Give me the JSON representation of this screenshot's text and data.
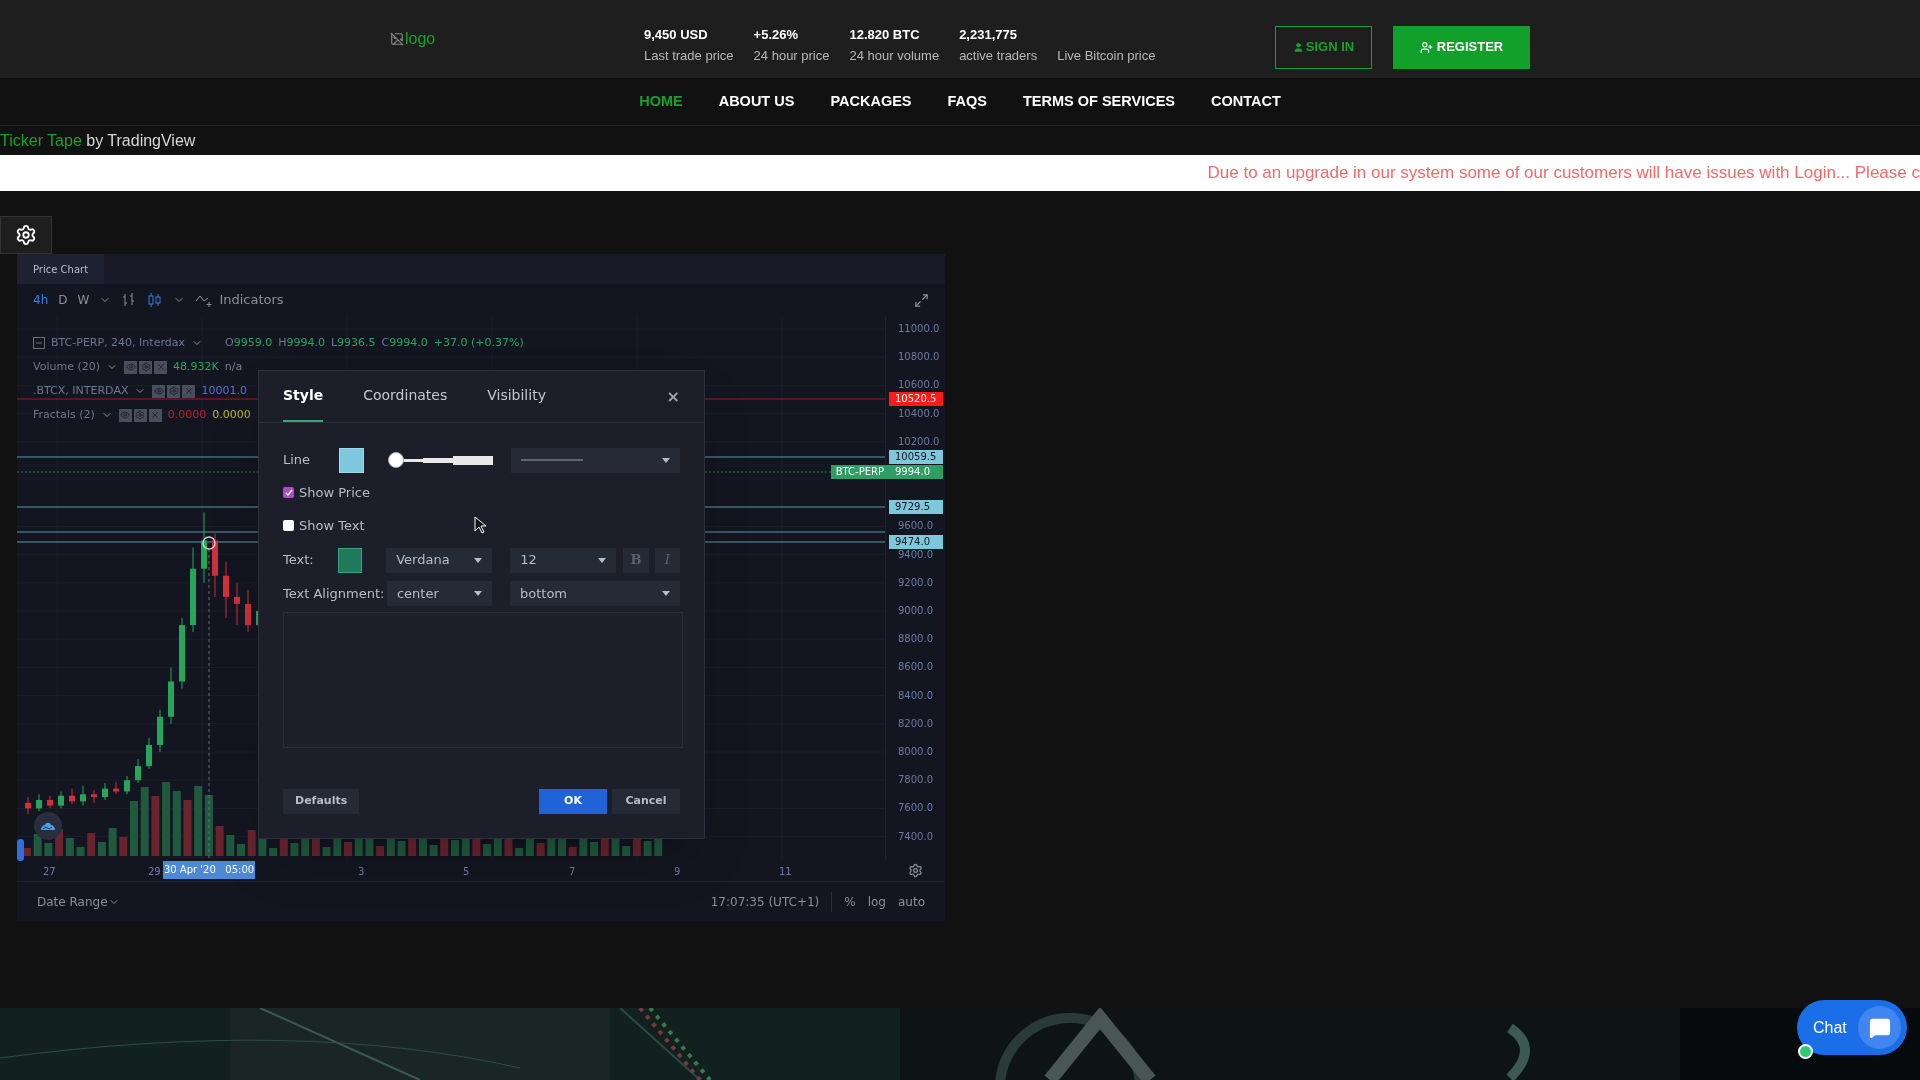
{
  "header": {
    "logo_alt": "logo",
    "stats": [
      {
        "value": "9,450 USD",
        "label": "Last trade price"
      },
      {
        "value": "+5.26%",
        "label": "24 hour price"
      },
      {
        "value": "12.820 BTC",
        "label": "24 hour volume"
      },
      {
        "value": "2,231,775",
        "label": "active traders"
      },
      {
        "label": "Live Bitcoin price"
      }
    ],
    "sign_in": "SIGN IN",
    "register": "REGISTER"
  },
  "nav": [
    {
      "label": "HOME",
      "selected": true
    },
    {
      "label": "ABOUT US",
      "selected": false
    },
    {
      "label": "PACKAGES",
      "selected": false
    },
    {
      "label": "FAQS",
      "selected": false
    },
    {
      "label": "TERMS OF SERVICES",
      "selected": false
    },
    {
      "label": "CONTACT",
      "selected": false
    }
  ],
  "ticker": {
    "link": "Ticker Tape",
    "suffix": "by TradingView"
  },
  "notice": "Due to an upgrade in our system some of our customers will have issues with Login... Please c",
  "chart_widget": {
    "tab": "Price Chart",
    "timeframes": [
      {
        "label": "4h",
        "selected": true
      },
      {
        "label": "D",
        "selected": false
      },
      {
        "label": "W",
        "selected": false
      }
    ],
    "indicators_label": "Indicators",
    "legend": [
      {
        "kind": "main",
        "name": "BTC-PERP, 240, Interdax",
        "ohlc": [
          {
            "key": "O",
            "value": "9959.0"
          },
          {
            "key": "H",
            "value": "9994.0"
          },
          {
            "key": "L",
            "value": "9936.5"
          },
          {
            "key": "C",
            "value": "9994.0"
          }
        ],
        "change": "+37.0 (+0.37%)"
      },
      {
        "kind": "study",
        "name": "Volume (20)",
        "values": [
          {
            "text": "48.932K",
            "color": "#26a65b"
          },
          {
            "text": "n/a",
            "color": "#7a8092"
          }
        ]
      },
      {
        "kind": "study",
        "name": ".BTCX, INTERDAX",
        "values": [
          {
            "text": "10001.0",
            "color": "#5b6fd8"
          }
        ]
      },
      {
        "kind": "study",
        "name": "Fractals (2)",
        "values": [
          {
            "text": "0.0000",
            "color": "#c0202a"
          },
          {
            "text": "0.0000",
            "color": "#b8b820"
          }
        ]
      }
    ],
    "price_axis": [
      "11000.0",
      "10800.0",
      "10600.0",
      "10400.0",
      "10200.0",
      "9600.0",
      "9400.0",
      "9200.0",
      "9000.0",
      "8800.0",
      "8600.0",
      "8400.0",
      "8200.0",
      "8000.0",
      "7800.0",
      "7600.0",
      "7400.0"
    ],
    "price_tags": [
      {
        "text": "10520.5",
        "color": "#ff1a1a"
      },
      {
        "text": "10059.5",
        "color": "#7ec8dc"
      },
      {
        "label": "BTC-PERP",
        "text": "9994.0",
        "color": "#2e9e64"
      },
      {
        "text": "9729.5",
        "color": "#7ec8dc"
      },
      {
        "text": "9474.0",
        "color": "#7ec8dc"
      }
    ],
    "time_axis": [
      "27",
      "29",
      "3",
      "5",
      "7",
      "9",
      "11"
    ],
    "crosshair_time": "30 Apr '20   05:00",
    "date_range": "Date Range",
    "clock": "17:07:35 (UTC+1)",
    "scale_options": [
      "%",
      "log",
      "auto"
    ]
  },
  "dialog": {
    "tabs": [
      {
        "label": "Style",
        "selected": true
      },
      {
        "label": "Coordinates",
        "selected": false
      },
      {
        "label": "Visibility",
        "selected": false
      }
    ],
    "close": "×",
    "line": {
      "label": "Line",
      "color": "#7ec8dc",
      "width": {
        "level": 0
      }
    },
    "show_price": {
      "label": "Show Price",
      "checked": true
    },
    "show_text": {
      "label": "Show Text",
      "checked": false
    },
    "text": {
      "label": "Text:",
      "color": "#1f7a5c",
      "font": "Verdana",
      "size": "12",
      "bold": {
        "label": "B",
        "on": false
      },
      "italic": {
        "label": "I",
        "on": false
      }
    },
    "alignment": {
      "label": "Text Alignment:",
      "horizontal": "center",
      "vertical": "bottom"
    },
    "buttons": {
      "defaults": "Defaults",
      "ok": "OK",
      "cancel": "Cancel"
    }
  },
  "chat": {
    "label": "Chat",
    "online": true
  }
}
